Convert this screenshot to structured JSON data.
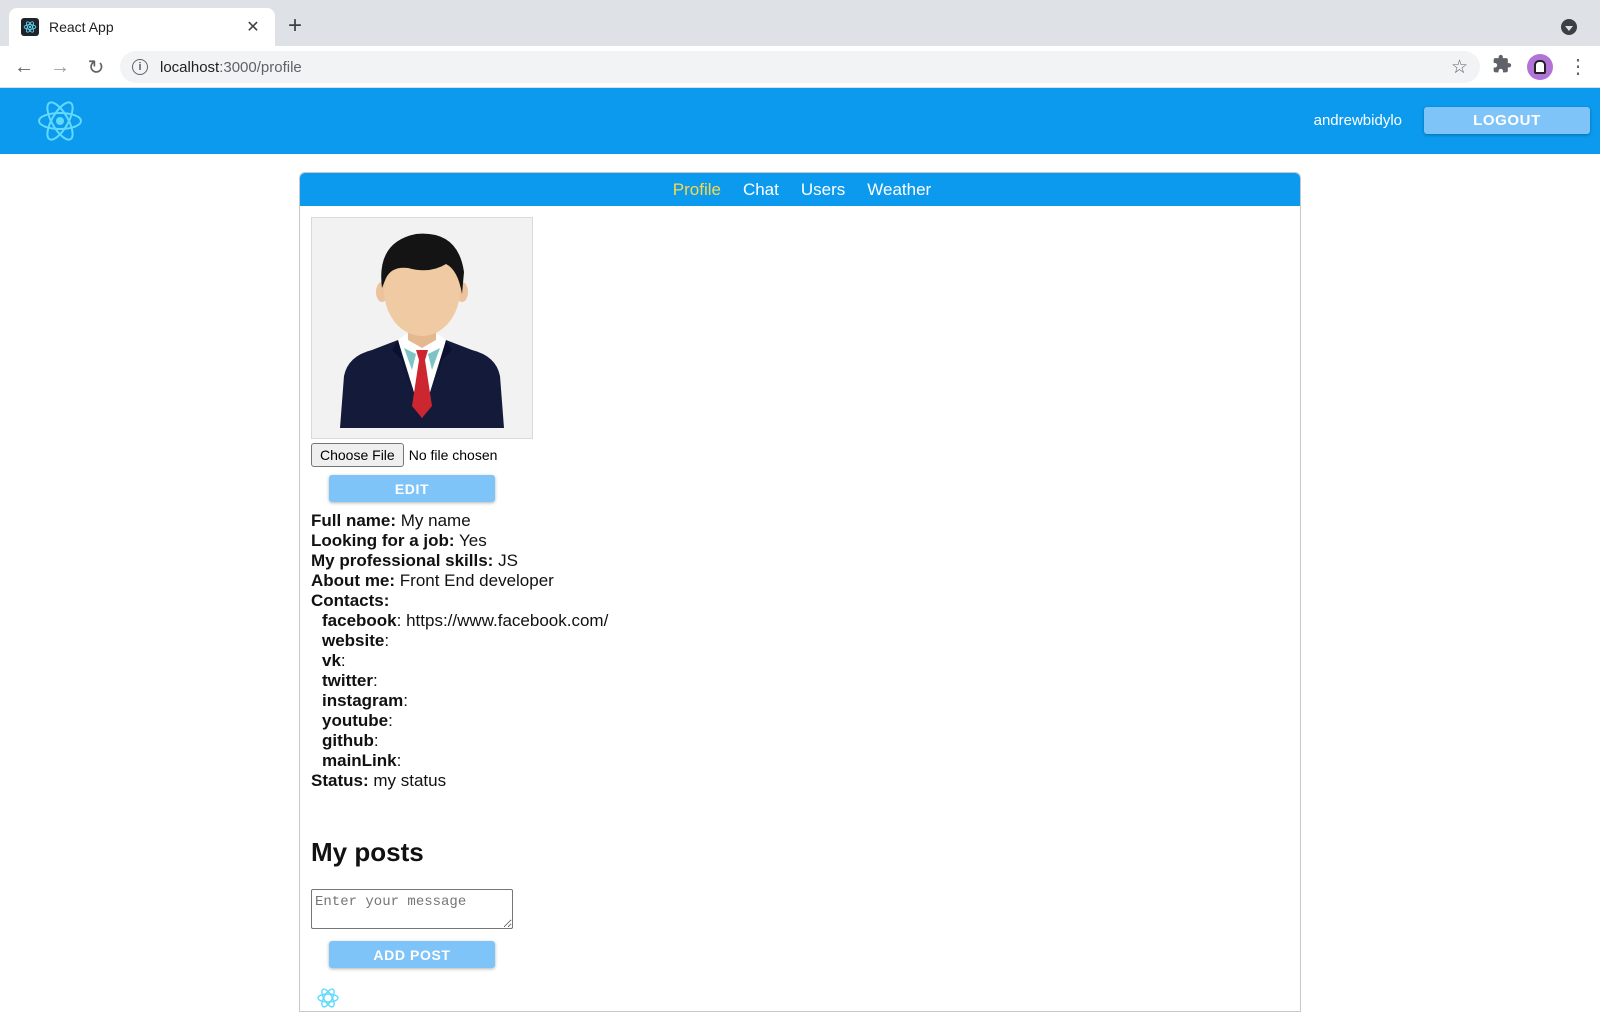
{
  "browser": {
    "tab_title": "React App",
    "tab_close": "✕",
    "new_tab": "+",
    "url_host": "localhost",
    "url_path": ":3000/profile",
    "back_icon": "←",
    "forward_icon": "→",
    "reload_icon": "↻",
    "star_icon": "☆",
    "extensions_icon": "puzzle-icon",
    "menu_icon": "⋮"
  },
  "header": {
    "username": "andrewbidylo",
    "logout_label": "LOGOUT"
  },
  "nav": {
    "items": [
      {
        "label": "Profile",
        "active": true
      },
      {
        "label": "Chat",
        "active": false
      },
      {
        "label": "Users",
        "active": false
      },
      {
        "label": "Weather",
        "active": false
      }
    ]
  },
  "profile": {
    "choose_file_label": "Choose File",
    "no_file_text": "No file chosen",
    "edit_label": "EDIT",
    "full_name_label": "Full name:",
    "full_name": "My name",
    "job_label": "Looking for a job:",
    "job_value": "Yes",
    "skills_label": "My professional skills:",
    "skills_value": "JS",
    "about_label": "About me:",
    "about_value": "Front End developer",
    "contacts_label": "Contacts:",
    "contacts": [
      {
        "name": "facebook",
        "value": "https://www.facebook.com/"
      },
      {
        "name": "website",
        "value": ""
      },
      {
        "name": "vk",
        "value": ""
      },
      {
        "name": "twitter",
        "value": ""
      },
      {
        "name": "instagram",
        "value": ""
      },
      {
        "name": "youtube",
        "value": ""
      },
      {
        "name": "github",
        "value": ""
      },
      {
        "name": "mainLink",
        "value": ""
      }
    ],
    "status_label": "Status:",
    "status_value": "my status"
  },
  "posts": {
    "title": "My posts",
    "placeholder": "Enter your message",
    "add_label": "ADD POST"
  },
  "colors": {
    "header_bg": "#0c9aee",
    "button_bg": "#7fc4f8",
    "active_nav": "#f6d94c",
    "react_logo": "#61dafb"
  }
}
